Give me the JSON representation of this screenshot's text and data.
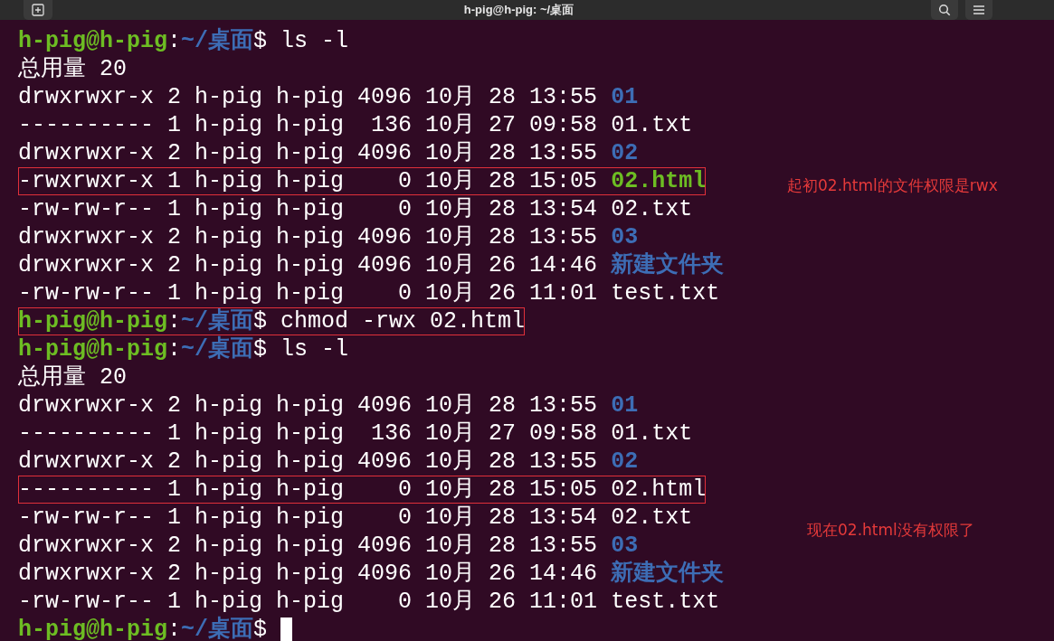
{
  "window": {
    "title": "h-pig@h-pig: ~/桌面"
  },
  "lines": [
    {
      "kind": "prompt",
      "user": "h-pig@h-pig",
      "separator": ":",
      "path": "~/桌面",
      "command": "$ ls -l",
      "highlighted": false
    },
    {
      "kind": "output",
      "text": "总用量 20",
      "highlighted": false
    },
    {
      "kind": "entry",
      "text": "drwxrwxr-x 2 h-pig h-pig 4096 10月 28 13:55",
      "name": "01",
      "directory": true,
      "executable": false,
      "highlighted": false
    },
    {
      "kind": "entry",
      "text": "---------- 1 h-pig h-pig  136 10月 27 09:58",
      "name": "01.txt",
      "directory": false,
      "executable": false,
      "highlighted": false
    },
    {
      "kind": "entry",
      "text": "drwxrwxr-x 2 h-pig h-pig 4096 10月 28 13:55",
      "name": "02",
      "directory": true,
      "executable": false,
      "highlighted": false
    },
    {
      "kind": "entry",
      "text": "-rwxrwxr-x 1 h-pig h-pig    0 10月 28 15:05",
      "name": "02.html",
      "directory": false,
      "executable": true,
      "highlighted": true
    },
    {
      "kind": "entry",
      "text": "-rw-rw-r-- 1 h-pig h-pig    0 10月 28 13:54",
      "name": "02.txt",
      "directory": false,
      "executable": false,
      "highlighted": false
    },
    {
      "kind": "entry",
      "text": "drwxrwxr-x 2 h-pig h-pig 4096 10月 28 13:55",
      "name": "03",
      "directory": true,
      "executable": false,
      "highlighted": false
    },
    {
      "kind": "entry",
      "text": "drwxrwxr-x 2 h-pig h-pig 4096 10月 26 14:46",
      "name": "新建文件夹",
      "directory": true,
      "executable": false,
      "highlighted": false
    },
    {
      "kind": "entry",
      "text": "-rw-rw-r-- 1 h-pig h-pig    0 10月 26 11:01",
      "name": "test.txt",
      "directory": false,
      "executable": false,
      "highlighted": false
    },
    {
      "kind": "prompt",
      "user": "h-pig@h-pig",
      "separator": ":",
      "path": "~/桌面",
      "command": "$ chmod -rwx 02.html",
      "highlighted": true
    },
    {
      "kind": "prompt",
      "user": "h-pig@h-pig",
      "separator": ":",
      "path": "~/桌面",
      "command": "$ ls -l",
      "highlighted": false
    },
    {
      "kind": "output",
      "text": "总用量 20",
      "highlighted": false
    },
    {
      "kind": "entry",
      "text": "drwxrwxr-x 2 h-pig h-pig 4096 10月 28 13:55",
      "name": "01",
      "directory": true,
      "executable": false,
      "highlighted": false
    },
    {
      "kind": "entry",
      "text": "---------- 1 h-pig h-pig  136 10月 27 09:58",
      "name": "01.txt",
      "directory": false,
      "executable": false,
      "highlighted": false
    },
    {
      "kind": "entry",
      "text": "drwxrwxr-x 2 h-pig h-pig 4096 10月 28 13:55",
      "name": "02",
      "directory": true,
      "executable": false,
      "highlighted": false
    },
    {
      "kind": "entry",
      "text": "---------- 1 h-pig h-pig    0 10月 28 15:05",
      "name": "02.html",
      "directory": false,
      "executable": false,
      "highlighted": true
    },
    {
      "kind": "entry",
      "text": "-rw-rw-r-- 1 h-pig h-pig    0 10月 28 13:54",
      "name": "02.txt",
      "directory": false,
      "executable": false,
      "highlighted": false
    },
    {
      "kind": "entry",
      "text": "drwxrwxr-x 2 h-pig h-pig 4096 10月 28 13:55",
      "name": "03",
      "directory": true,
      "executable": false,
      "highlighted": false
    },
    {
      "kind": "entry",
      "text": "drwxrwxr-x 2 h-pig h-pig 4096 10月 26 14:46",
      "name": "新建文件夹",
      "directory": true,
      "executable": false,
      "highlighted": false
    },
    {
      "kind": "entry",
      "text": "-rw-rw-r-- 1 h-pig h-pig    0 10月 26 11:01",
      "name": "test.txt",
      "directory": false,
      "executable": false,
      "highlighted": false
    },
    {
      "kind": "prompt",
      "user": "h-pig@h-pig",
      "separator": ":",
      "path": "~/桌面",
      "command": "$",
      "highlighted": false,
      "cursor": true
    }
  ],
  "annotations": [
    {
      "text": "起初02.html的文件权限是rwx"
    },
    {
      "text": "现在02.html没有权限了"
    }
  ]
}
